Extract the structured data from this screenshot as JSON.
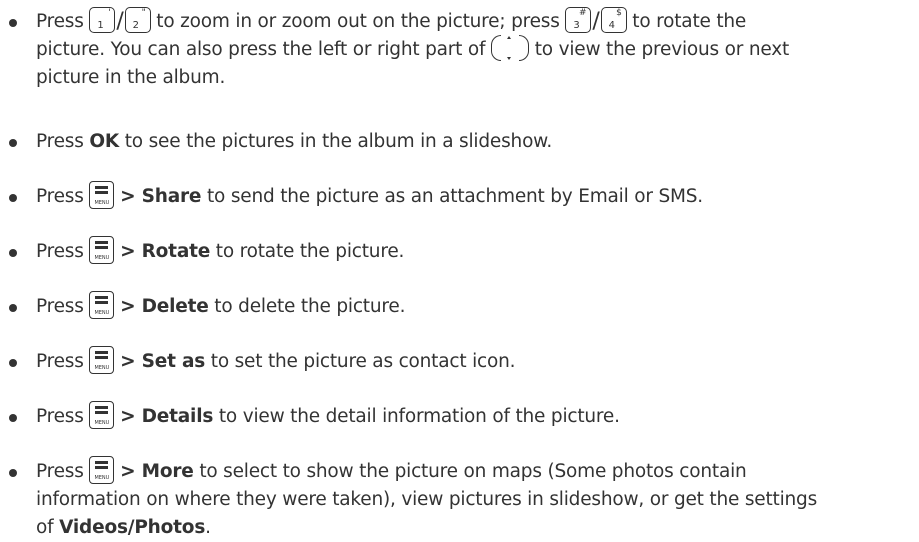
{
  "items": [
    {
      "press": "Press",
      "mid1": "to zoom in or zoom out on the picture; press",
      "mid2": "to rotate the",
      "line2": "picture. You can also press the left or right part of",
      "line2_end": "to view the previous or next",
      "line3": "picture in the album.",
      "keys": [
        {
          "num": "1",
          "sym": "'"
        },
        {
          "num": "2",
          "sym": "\""
        },
        {
          "num": "3",
          "sym": "#"
        },
        {
          "num": "4",
          "sym": "$"
        }
      ],
      "nav_icon": "navigation-key-icon"
    },
    {
      "press": "Press",
      "bold": "OK",
      "rest": "to see the pictures in the album in a slideshow."
    },
    {
      "press": "Press",
      "menu_label": "MENU",
      "bold": "> Share",
      "rest": "to send the picture as an attachment by Email or SMS."
    },
    {
      "press": "Press",
      "menu_label": "MENU",
      "bold": "> Rotate",
      "rest": "to rotate the picture."
    },
    {
      "press": "Press",
      "menu_label": "MENU",
      "bold": "> Delete",
      "rest": "to delete the picture."
    },
    {
      "press": "Press",
      "menu_label": "MENU",
      "bold": "> Set as",
      "rest": "to set the picture as contact icon."
    },
    {
      "press": "Press",
      "menu_label": "MENU",
      "bold": "> Details",
      "rest": "to view the detail information of the picture."
    },
    {
      "press": "Press",
      "menu_label": "MENU",
      "bold": "> More",
      "rest": "to select to show the picture on maps (Some photos contain",
      "line2": "information on where they were taken), view pictures in slideshow, or get the settings",
      "line3_pre": "of",
      "line3_bold": "Videos/Photos",
      "line3_post": "."
    }
  ],
  "colors": {
    "text": "#333333",
    "background": "#ffffff"
  }
}
